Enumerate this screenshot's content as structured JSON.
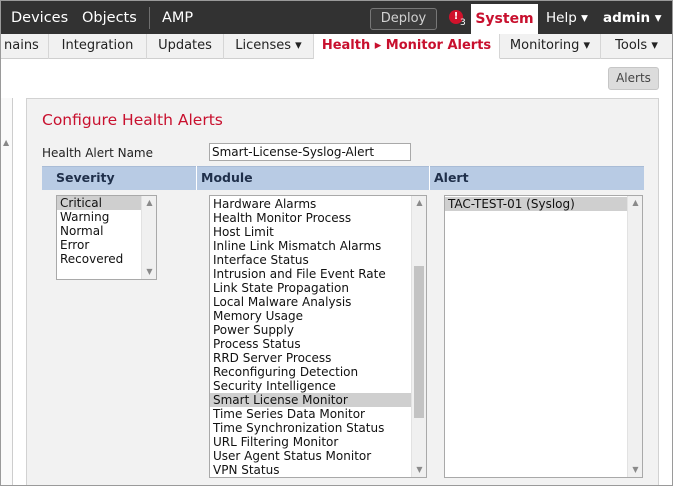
{
  "topnav": {
    "devices": "Devices",
    "objects": "Objects",
    "amp": "AMP",
    "deploy": "Deploy",
    "alert_badge_icon": "!",
    "alert_count": "3",
    "system": "System",
    "help": "Help ▾",
    "admin": "admin ▾"
  },
  "subnav": {
    "domains": "nains",
    "integration": "Integration",
    "updates": "Updates",
    "licenses": "Licenses ▾",
    "health_monitor_alerts": "Health ▸ Monitor Alerts",
    "monitoring": "Monitoring ▾",
    "tools": "Tools ▾"
  },
  "alerts_button": "Alerts",
  "form": {
    "title": "Configure Health Alerts",
    "name_label": "Health Alert Name",
    "name_value": "Smart-License-Syslog-Alert",
    "headers": {
      "severity": "Severity",
      "module": "Module",
      "alert": "Alert"
    }
  },
  "severity_items": [
    "Critical",
    "Warning",
    "Normal",
    "Error",
    "Recovered"
  ],
  "severity_selected_index": 0,
  "module_items": [
    "Hardware Alarms",
    "Health Monitor Process",
    "Host Limit",
    "Inline Link Mismatch Alarms",
    "Interface Status",
    "Intrusion and File Event Rate",
    "Link State Propagation",
    "Local Malware Analysis",
    "Memory Usage",
    "Power Supply",
    "Process Status",
    "RRD Server Process",
    "Reconfiguring Detection",
    "Security Intelligence",
    "Smart License Monitor",
    "Time Series Data Monitor",
    "Time Synchronization Status",
    "URL Filtering Monitor",
    "User Agent Status Monitor",
    "VPN Status"
  ],
  "module_selected_index": 14,
  "module_scroll_position": 0.55,
  "alert_items": [
    "TAC-TEST-01 (Syslog)"
  ],
  "alert_selected_index": 0,
  "icons": {
    "scroll_up": "▲",
    "scroll_down": "▼"
  },
  "colors": {
    "accent": "#c8102e",
    "header_bg": "#b8cbe4",
    "topbar_bg": "#323232"
  }
}
